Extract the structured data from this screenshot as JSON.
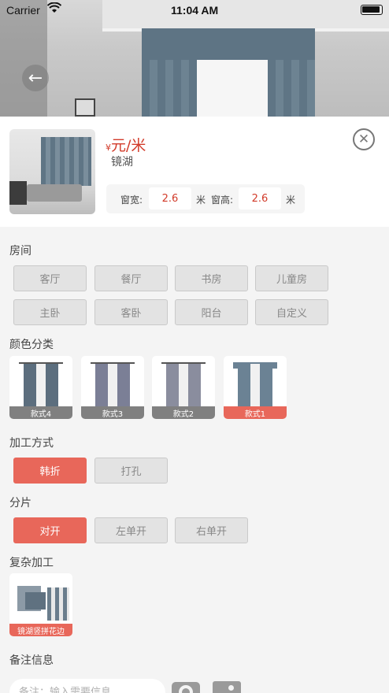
{
  "status_bar": {
    "carrier": "Carrier",
    "time": "11:04 AM",
    "wifi_icon": "wifi-icon"
  },
  "product": {
    "price_symbol": "¥",
    "price_unit": "元/米",
    "name": "镜湖",
    "width_label": "窗宽:",
    "width_value": "2.6",
    "width_unit": "米",
    "height_label": "窗高:",
    "height_value": "2.6",
    "height_unit": "米"
  },
  "sections": {
    "room": {
      "title": "房间",
      "options": [
        "客厅",
        "餐厅",
        "书房",
        "儿童房",
        "主卧",
        "客卧",
        "阳台",
        "自定义"
      ]
    },
    "color": {
      "title": "颜色分类",
      "options": [
        "款式4",
        "款式3",
        "款式2",
        "款式1"
      ],
      "selected": "款式1"
    },
    "process": {
      "title": "加工方式",
      "options": [
        "韩折",
        "打孔"
      ],
      "selected": "韩折"
    },
    "split": {
      "title": "分片",
      "options": [
        "对开",
        "左单开",
        "右单开"
      ],
      "selected": "对开"
    },
    "complex": {
      "title": "复杂加工",
      "item": "镜湖竖拼花边"
    },
    "note": {
      "title": "备注信息",
      "placeholder": "备注：输入需要信息"
    }
  },
  "colors": {
    "accent": "#e8675a",
    "price": "#d23b2a"
  }
}
